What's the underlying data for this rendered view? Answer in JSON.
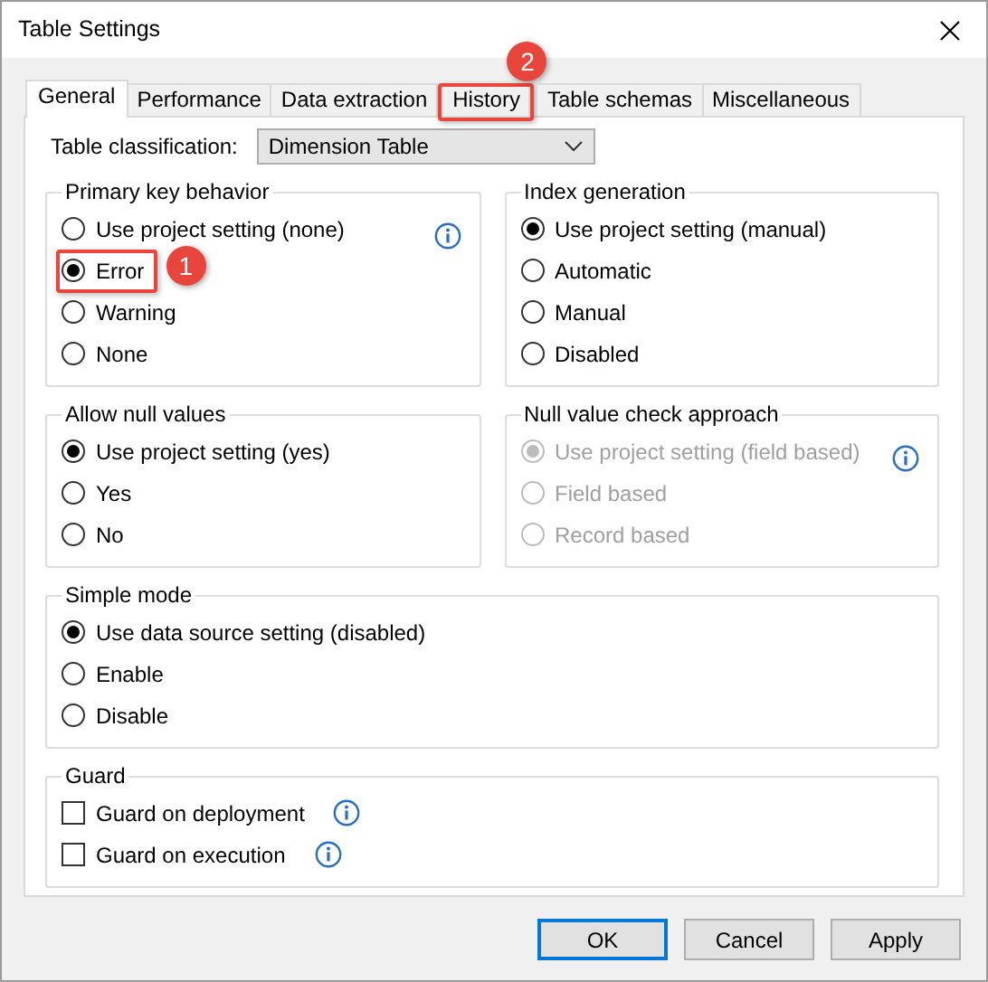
{
  "window": {
    "title": "Table Settings"
  },
  "tabs": [
    {
      "label": "General",
      "selected": true
    },
    {
      "label": "Performance",
      "selected": false
    },
    {
      "label": "Data extraction",
      "selected": false
    },
    {
      "label": "History",
      "selected": false,
      "annotation": "2"
    },
    {
      "label": "Table schemas",
      "selected": false
    },
    {
      "label": "Miscellaneous",
      "selected": false
    }
  ],
  "classification": {
    "label": "Table classification:",
    "value": "Dimension Table"
  },
  "groups": [
    {
      "title": "Primary key behavior",
      "kind": "radio",
      "wide": false,
      "info": true,
      "options": [
        {
          "label": "Use project setting (none)",
          "selected": false,
          "disabled": false
        },
        {
          "label": "Error",
          "selected": true,
          "disabled": false,
          "annotation": "1"
        },
        {
          "label": "Warning",
          "selected": false,
          "disabled": false
        },
        {
          "label": "None",
          "selected": false,
          "disabled": false
        }
      ]
    },
    {
      "title": "Index generation",
      "kind": "radio",
      "wide": false,
      "info": false,
      "options": [
        {
          "label": "Use project setting (manual)",
          "selected": true,
          "disabled": false
        },
        {
          "label": "Automatic",
          "selected": false,
          "disabled": false
        },
        {
          "label": "Manual",
          "selected": false,
          "disabled": false
        },
        {
          "label": "Disabled",
          "selected": false,
          "disabled": false
        }
      ]
    },
    {
      "title": "Allow null values",
      "kind": "radio",
      "wide": false,
      "info": false,
      "options": [
        {
          "label": "Use project setting (yes)",
          "selected": true,
          "disabled": false
        },
        {
          "label": "Yes",
          "selected": false,
          "disabled": false
        },
        {
          "label": "No",
          "selected": false,
          "disabled": false
        }
      ]
    },
    {
      "title": "Null value check approach",
      "kind": "radio",
      "wide": false,
      "info": true,
      "options": [
        {
          "label": "Use project setting (field based)",
          "selected": true,
          "disabled": true
        },
        {
          "label": "Field based",
          "selected": false,
          "disabled": true
        },
        {
          "label": "Record based",
          "selected": false,
          "disabled": true
        }
      ]
    },
    {
      "title": "Simple mode",
      "kind": "radio",
      "wide": true,
      "info": false,
      "options": [
        {
          "label": "Use data source setting (disabled)",
          "selected": true,
          "disabled": false
        },
        {
          "label": "Enable",
          "selected": false,
          "disabled": false
        },
        {
          "label": "Disable",
          "selected": false,
          "disabled": false
        }
      ]
    },
    {
      "title": "Guard",
      "kind": "checkbox",
      "wide": true,
      "info": false,
      "options": [
        {
          "label": "Guard on deployment",
          "checked": false,
          "info": true
        },
        {
          "label": "Guard on execution",
          "checked": false,
          "info": true
        }
      ]
    }
  ],
  "buttons": [
    {
      "label": "OK",
      "default": true
    },
    {
      "label": "Cancel",
      "default": false
    },
    {
      "label": "Apply",
      "default": false
    }
  ]
}
